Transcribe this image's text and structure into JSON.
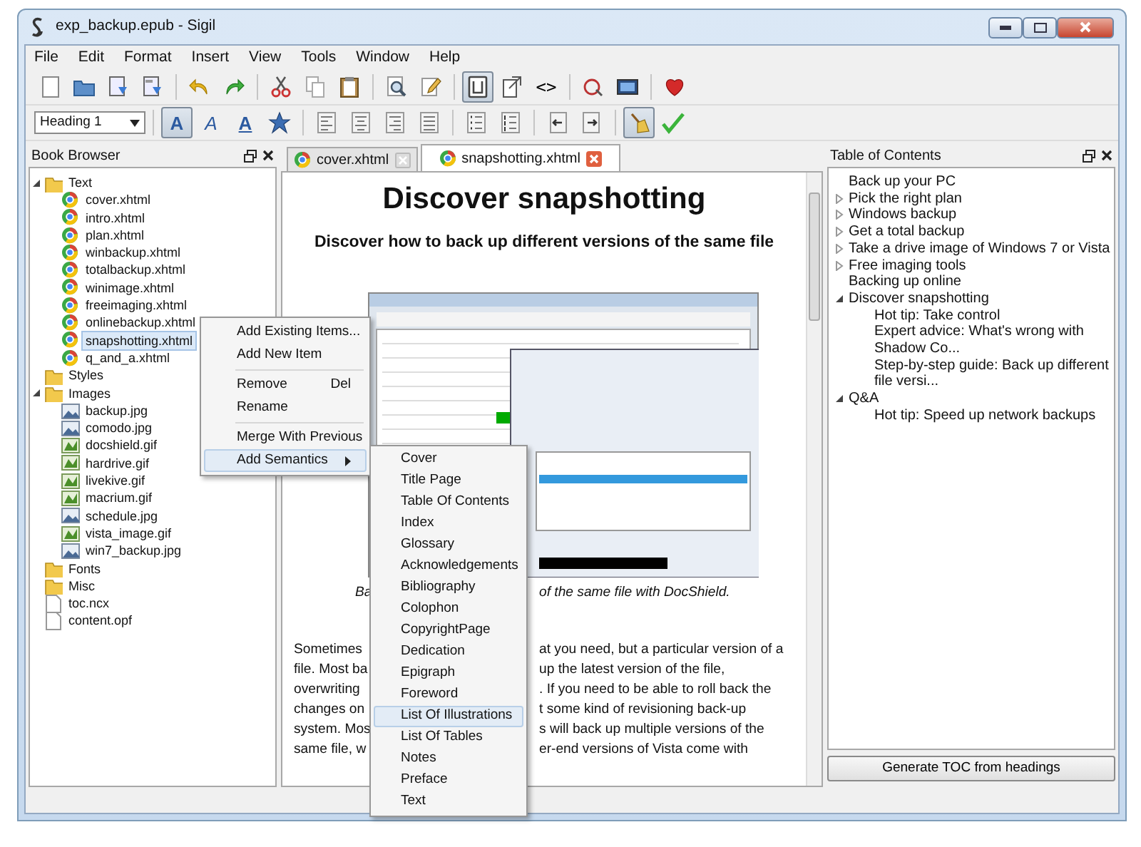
{
  "window": {
    "title": "exp_backup.epub - Sigil"
  },
  "menu_bar": [
    "File",
    "Edit",
    "Format",
    "Insert",
    "View",
    "Tools",
    "Window",
    "Help"
  ],
  "main_toolbar": {
    "buttons": [
      {
        "pressed": false
      },
      {
        "pressed": false
      },
      {
        "pressed": false
      },
      {
        "pressed": false
      },
      {
        "pressed": false
      },
      {
        "pressed": false
      },
      {
        "pressed": false
      },
      {
        "pressed": false
      },
      {
        "pressed": false
      },
      {
        "pressed": false
      },
      {
        "pressed": false
      },
      {
        "pressed": true
      },
      {
        "pressed": false
      },
      {
        "label": "<>",
        "pressed": false
      },
      {
        "pressed": false
      },
      {
        "pressed": false
      },
      {
        "pressed": false
      }
    ]
  },
  "format_toolbar": {
    "heading_select": "Heading 1",
    "buttons": [
      {
        "label": "A",
        "pressed": true
      },
      {
        "label": "A",
        "pressed": false
      },
      {
        "label": "A",
        "pressed": false
      },
      {
        "pressed": false
      },
      {
        "pressed": false
      },
      {
        "pressed": false
      },
      {
        "pressed": false
      },
      {
        "pressed": false
      },
      {
        "pressed": false
      },
      {
        "pressed": false
      },
      {
        "pressed": false
      },
      {
        "pressed": false
      },
      {
        "pressed": true
      },
      {
        "pressed": false
      }
    ]
  },
  "book_browser": {
    "title": "Book Browser",
    "tree": [
      {
        "kind": "folder",
        "label": "Text",
        "expanded": true,
        "selected": false,
        "children": [
          {
            "kind": "page",
            "label": "cover.xhtml",
            "selected": false
          },
          {
            "kind": "page",
            "label": "intro.xhtml",
            "selected": false
          },
          {
            "kind": "page",
            "label": "plan.xhtml",
            "selected": false
          },
          {
            "kind": "page",
            "label": "winbackup.xhtml",
            "selected": false
          },
          {
            "kind": "page",
            "label": "totalbackup.xhtml",
            "selected": false
          },
          {
            "kind": "page",
            "label": "winimage.xhtml",
            "selected": false
          },
          {
            "kind": "page",
            "label": "freeimaging.xhtml",
            "selected": false
          },
          {
            "kind": "page",
            "label": "onlinebackup.xhtml",
            "selected": false
          },
          {
            "kind": "page",
            "label": "snapshotting.xhtml",
            "selected": true
          },
          {
            "kind": "page",
            "label": "q_and_a.xhtml",
            "selected": false
          }
        ]
      },
      {
        "kind": "folder",
        "label": "Styles",
        "selected": false
      },
      {
        "kind": "folder",
        "label": "Images",
        "expanded": true,
        "selected": false,
        "children": [
          {
            "kind": "jpg",
            "label": "backup.jpg",
            "selected": false
          },
          {
            "kind": "jpg",
            "label": "comodo.jpg",
            "selected": false
          },
          {
            "kind": "gif",
            "label": "docshield.gif",
            "selected": false
          },
          {
            "kind": "gif",
            "label": "hardrive.gif",
            "selected": false
          },
          {
            "kind": "gif",
            "label": "livekive.gif",
            "selected": false
          },
          {
            "kind": "gif",
            "label": "macrium.gif",
            "selected": false
          },
          {
            "kind": "jpg",
            "label": "schedule.jpg",
            "selected": false
          },
          {
            "kind": "gif",
            "label": "vista_image.gif",
            "selected": false
          },
          {
            "kind": "jpg",
            "label": "win7_backup.jpg",
            "selected": false
          }
        ]
      },
      {
        "kind": "folder",
        "label": "Fonts",
        "selected": false
      },
      {
        "kind": "folder",
        "label": "Misc",
        "selected": false
      },
      {
        "kind": "file",
        "label": "toc.ncx",
        "selected": false
      },
      {
        "kind": "file",
        "label": "content.opf",
        "selected": false
      }
    ]
  },
  "editor": {
    "tabs": [
      {
        "label": "cover.xhtml",
        "selected": false
      },
      {
        "label": "snapshotting.xhtml",
        "selected": true
      }
    ],
    "heading": "Discover snapshotting",
    "subtitle": "Discover how to back up different versions of the same file",
    "caption": {
      "left": "Ba",
      "right": "of the same file with DocShield."
    },
    "paragraph_lines": [
      {
        "left": "Sometimes",
        "right": "at you need, but a particular version of a"
      },
      {
        "left": "file. Most ba",
        "right": "up the latest version of the file,"
      },
      {
        "left": "overwriting",
        "right": ". If you need to be able to roll back the"
      },
      {
        "left": "changes on",
        "right": "t some kind of revisioning back-up"
      },
      {
        "left": "system. Mos",
        "right": "s will back up multiple versions of the"
      },
      {
        "left": "same file, w",
        "right": "er-end versions of Vista come with"
      }
    ]
  },
  "context_menu": [
    {
      "kind": "item",
      "label": "Add Existing Items...",
      "selected": false
    },
    {
      "kind": "item",
      "label": "Add New Item",
      "selected": false
    },
    {
      "kind": "separator"
    },
    {
      "kind": "item",
      "label": "Remove",
      "shortcut": "Del",
      "selected": false
    },
    {
      "kind": "item",
      "label": "Rename",
      "selected": false
    },
    {
      "kind": "separator"
    },
    {
      "kind": "item",
      "label": "Merge With Previous",
      "selected": false
    },
    {
      "kind": "submenu",
      "label": "Add Semantics",
      "selected": true
    }
  ],
  "semantics_menu": [
    {
      "label": "Cover",
      "selected": false
    },
    {
      "label": "Title Page",
      "selected": false
    },
    {
      "label": "Table Of Contents",
      "selected": false
    },
    {
      "label": "Index",
      "selected": false
    },
    {
      "label": "Glossary",
      "selected": false
    },
    {
      "label": "Acknowledgements",
      "selected": false
    },
    {
      "label": "Bibliography",
      "selected": false
    },
    {
      "label": "Colophon",
      "selected": false
    },
    {
      "label": "CopyrightPage",
      "selected": false
    },
    {
      "label": "Dedication",
      "selected": false
    },
    {
      "label": "Epigraph",
      "selected": false
    },
    {
      "label": "Foreword",
      "selected": false
    },
    {
      "label": "List Of Illustrations",
      "selected": true
    },
    {
      "label": "List Of Tables",
      "selected": false
    },
    {
      "label": "Notes",
      "selected": false
    },
    {
      "label": "Preface",
      "selected": false
    },
    {
      "label": "Text",
      "selected": false
    }
  ],
  "table_of_contents": {
    "title": "Table of Contents",
    "items": [
      {
        "label": "Back up your PC"
      },
      {
        "label": "Pick the right plan",
        "expanded": false
      },
      {
        "label": "Windows backup",
        "expanded": false
      },
      {
        "label": "Get a total backup",
        "expanded": false
      },
      {
        "label": "Take a drive image of Windows 7 or Vista",
        "expanded": false
      },
      {
        "label": "Free imaging tools",
        "expanded": false
      },
      {
        "label": "Backing up online"
      },
      {
        "label": "Discover snapshotting",
        "expanded": true,
        "children": [
          {
            "label": "Hot tip: Take control"
          },
          {
            "label": "Expert advice: What's wrong with Shadow Co..."
          },
          {
            "label": "Step-by-step guide: Back up different file versi..."
          }
        ]
      },
      {
        "label": "Q&A",
        "expanded": true,
        "children": [
          {
            "label": "Hot tip: Speed up network backups"
          }
        ]
      }
    ],
    "button": "Generate TOC from headings"
  }
}
